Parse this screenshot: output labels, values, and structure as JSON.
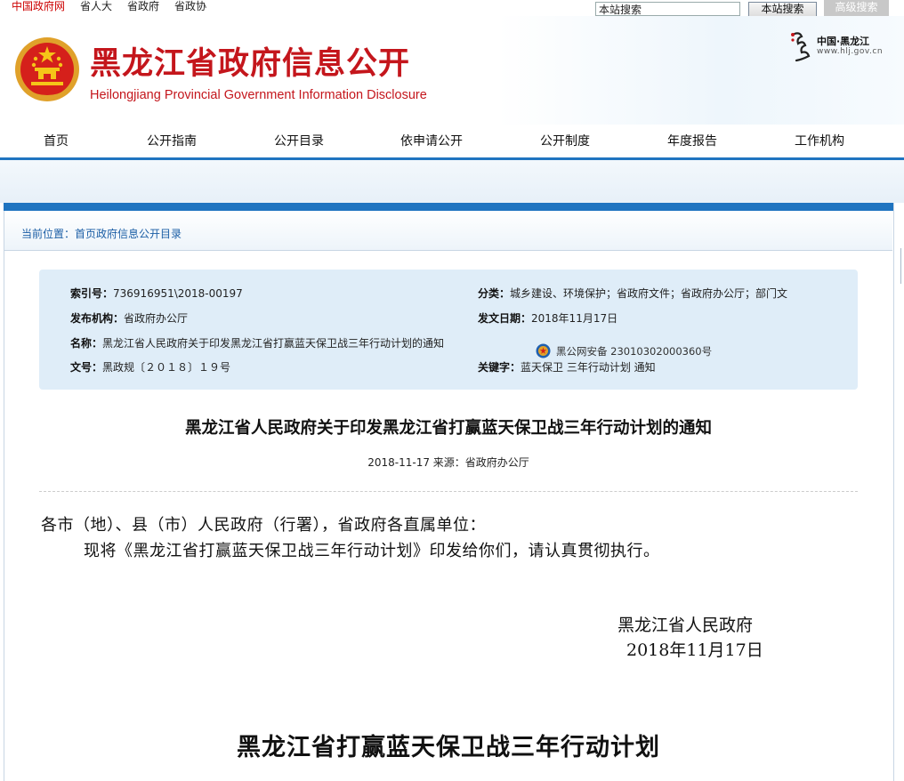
{
  "topbar": {
    "links": [
      "中国政府网",
      "省人大",
      "省政府",
      "省政协"
    ],
    "search_value": "本站搜索",
    "search_button": "本站搜索",
    "advanced_button": "高级搜索"
  },
  "header": {
    "title": "黑龙江省政府信息公开",
    "subtitle": "Heilongjiang Provincial Government Information Disclosure",
    "brand_cn": "中国·黑龙江",
    "brand_url": "www.hlj.gov.cn"
  },
  "nav": [
    "首页",
    "公开指南",
    "公开目录",
    "依申请公开",
    "公开制度",
    "年度报告",
    "工作机构"
  ],
  "breadcrumb": "当前位置：首页政府信息公开目录",
  "meta": {
    "index_label": "索引号：",
    "index_value": "736916951\\2018-00197",
    "category_label": "分类：",
    "category_value": "城乡建设、环境保护；省政府文件；省政府办公厅；部门文",
    "publisher_label": "发布机构：",
    "publisher_value": "省政府办公厅",
    "date_label": "发文日期：",
    "date_value": "2018年11月17日",
    "name_label": "名称：",
    "name_value": "黑龙江省人民政府关于印发黑龙江省打赢蓝天保卫战三年行动计划的通知",
    "doc_label": "文号：",
    "doc_value": "黑政规〔２０１８〕１９号",
    "keyword_label": "关键字：",
    "keyword_value": "蓝天保卫 三年行动计划 通知",
    "police_text": "黑公网安备 23010302000360号"
  },
  "article": {
    "title": "黑龙江省人民政府关于印发黑龙江省打赢蓝天保卫战三年行动计划的通知",
    "meta": "2018-11-17 来源：省政府办公厅",
    "salutation": "各市（地）、县（市）人民政府（行署），省政府各直属单位：",
    "body": "现将《黑龙江省打赢蓝天保卫战三年行动计划》印发给你们，请认真贯彻执行。",
    "signature": "黑龙江省人民政府",
    "sign_date": "2018年11月17日",
    "plan_title": "黑龙江省打赢蓝天保卫战三年行动计划"
  },
  "colors": {
    "brand_red": "#c4161c",
    "nav_blue": "#1f74c0",
    "meta_bg": "#dfedf8"
  }
}
